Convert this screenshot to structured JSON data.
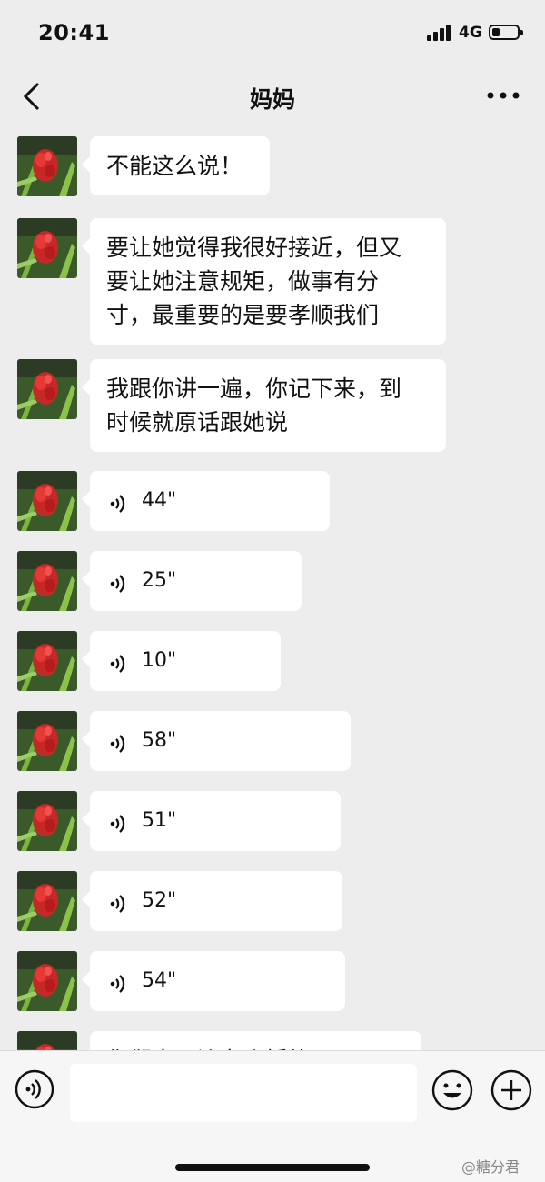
{
  "status_bar": {
    "time": "20:41",
    "network": "4G"
  },
  "header": {
    "title": "妈妈"
  },
  "messages": [
    {
      "type": "text",
      "lines": [
        "不能这么说！"
      ]
    },
    {
      "type": "text",
      "lines": [
        "要让她觉得我很好接近，但又",
        "要让她注意规矩，做事有分",
        "寸，最重要的是要孝顺我们"
      ]
    },
    {
      "type": "text",
      "lines": [
        "我跟你讲一遍，你记下来，到",
        "时候就原话跟她说"
      ]
    },
    {
      "type": "voice",
      "duration": "44\""
    },
    {
      "type": "voice",
      "duration": "25\""
    },
    {
      "type": "voice",
      "duration": "10\""
    },
    {
      "type": "voice",
      "duration": "58\""
    },
    {
      "type": "voice",
      "duration": "51\""
    },
    {
      "type": "voice",
      "duration": "52\""
    },
    {
      "type": "voice",
      "duration": "54\""
    },
    {
      "type": "text",
      "lines": [
        "你们去那边办个婚礼吧"
      ]
    }
  ],
  "input": {
    "value": ""
  },
  "watermark": "@糖分君",
  "colors": {
    "background": "#ededed",
    "bubble": "#ffffff",
    "text": "#111111"
  }
}
